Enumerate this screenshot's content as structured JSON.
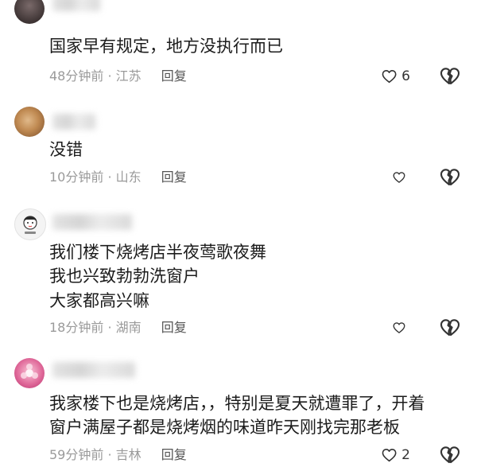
{
  "comments": [
    {
      "text_lines": [
        "国家早有规定，地方没执行而已"
      ],
      "time": "48分钟前",
      "location": "江苏",
      "reply_label": "回复",
      "like_count": "6"
    },
    {
      "text_lines": [
        "没错"
      ],
      "time": "10分钟前",
      "location": "山东",
      "reply_label": "回复",
      "like_count": ""
    },
    {
      "text_lines": [
        "我们楼下烧烤店半夜莺歌夜舞",
        "我也兴致勃勃洗窗户",
        "大家都高兴嘛"
      ],
      "time": "18分钟前",
      "location": "湖南",
      "reply_label": "回复",
      "like_count": ""
    },
    {
      "text_lines": [
        "我家楼下也是烧烤店，，特别是夏天就遭罪了，开着",
        "窗户满屋子都是烧烤烟的味道昨天刚找完那老板"
      ],
      "time": "59分钟前",
      "location": "吉林",
      "reply_label": "回复",
      "like_count": "2"
    }
  ],
  "separator": "·",
  "icons": {
    "like": "heart-outline-icon",
    "dislike": "broken-heart-icon"
  }
}
